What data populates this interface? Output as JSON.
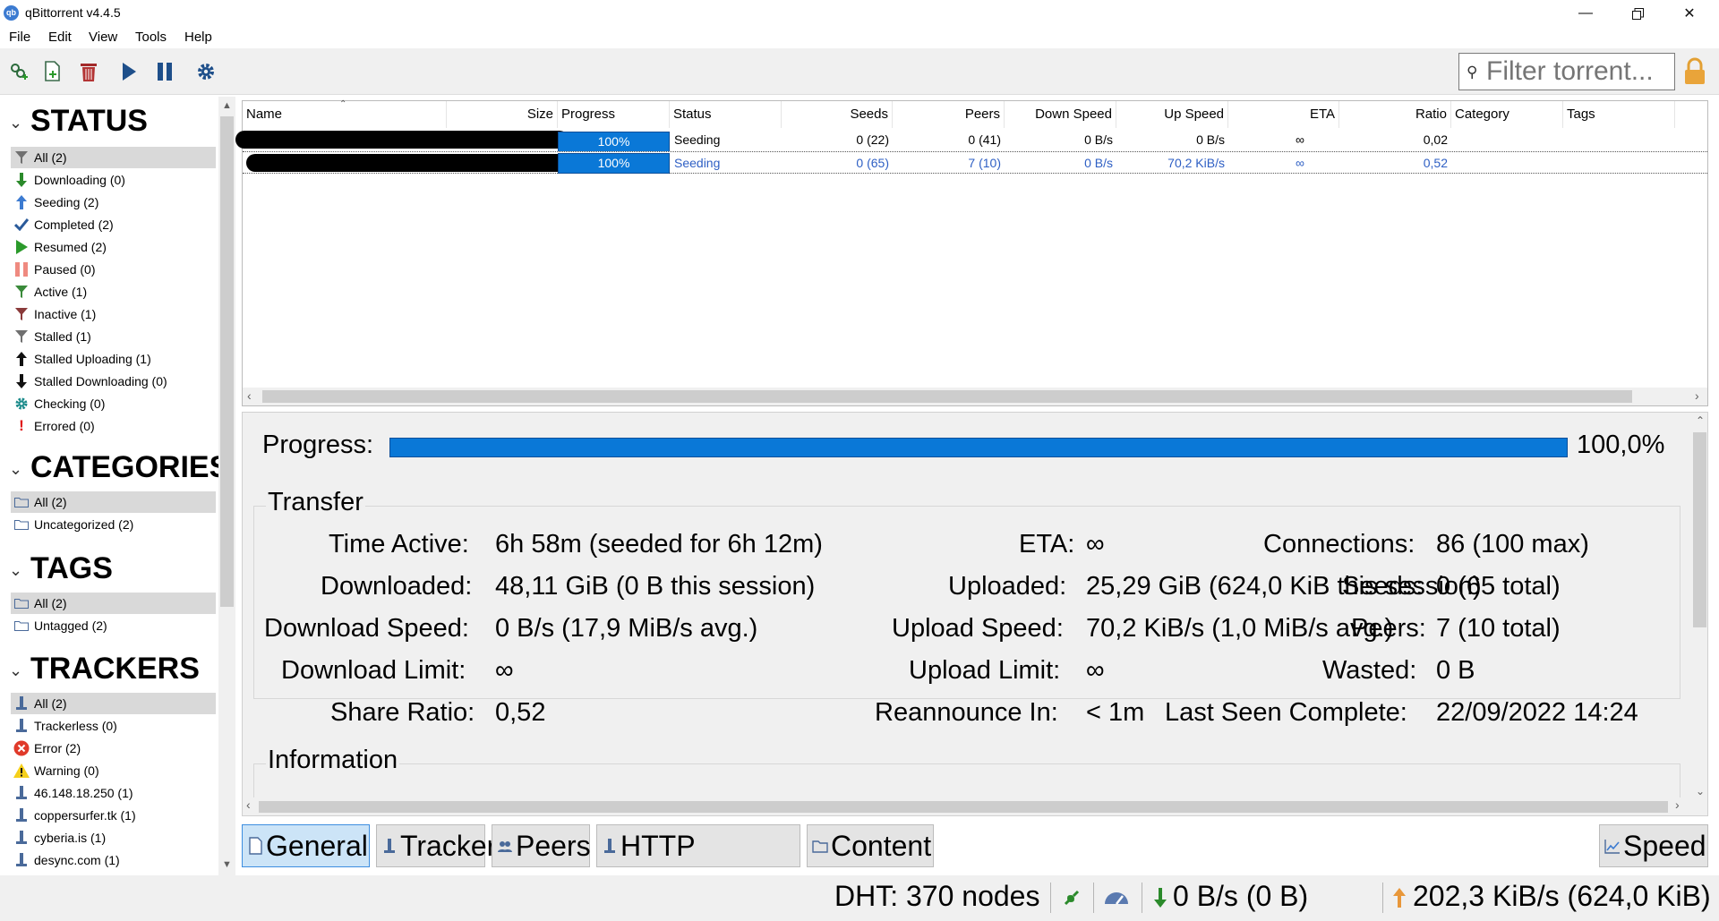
{
  "window": {
    "title": "qBittorrent v4.4.5",
    "icon_text": "qb"
  },
  "menu": [
    "File",
    "Edit",
    "View",
    "Tools",
    "Help"
  ],
  "toolbar": {
    "filter_placeholder": "Filter torrent..."
  },
  "sidebar": {
    "status_header": "STATUS",
    "status_items": [
      {
        "label": "All (2)",
        "icon": "filter-icon"
      },
      {
        "label": "Downloading (0)",
        "icon": "download-arrow-icon"
      },
      {
        "label": "Seeding (2)",
        "icon": "upload-arrow-icon"
      },
      {
        "label": "Completed (2)",
        "icon": "checkmark-icon"
      },
      {
        "label": "Resumed (2)",
        "icon": "play-icon"
      },
      {
        "label": "Paused (0)",
        "icon": "pause-icon"
      },
      {
        "label": "Active (1)",
        "icon": "filter-green-icon"
      },
      {
        "label": "Inactive (1)",
        "icon": "filter-red-icon"
      },
      {
        "label": "Stalled (1)",
        "icon": "filter-gray-icon"
      },
      {
        "label": "Stalled Uploading (1)",
        "icon": "stalled-up-icon"
      },
      {
        "label": "Stalled Downloading (0)",
        "icon": "stalled-down-icon"
      },
      {
        "label": "Checking (0)",
        "icon": "gear-icon"
      },
      {
        "label": "Errored (0)",
        "icon": "exclamation-icon"
      }
    ],
    "categories_header": "CATEGORIES",
    "category_items": [
      {
        "label": "All (2)",
        "icon": "folder-icon"
      },
      {
        "label": "Uncategorized (2)",
        "icon": "folder-icon"
      }
    ],
    "tags_header": "TAGS",
    "tag_items": [
      {
        "label": "All (2)",
        "icon": "folder-icon"
      },
      {
        "label": "Untagged (2)",
        "icon": "folder-icon"
      }
    ],
    "trackers_header": "TRACKERS",
    "tracker_items": [
      {
        "label": "All (2)",
        "icon": "tracker-icon"
      },
      {
        "label": "Trackerless (0)",
        "icon": "tracker-icon"
      },
      {
        "label": "Error (2)",
        "icon": "error-icon"
      },
      {
        "label": "Warning (0)",
        "icon": "warning-icon"
      },
      {
        "label": "46.148.18.250 (1)",
        "icon": "tracker-icon"
      },
      {
        "label": "coppersurfer.tk (1)",
        "icon": "tracker-icon"
      },
      {
        "label": "cyberia.is (1)",
        "icon": "tracker-icon"
      },
      {
        "label": "desync.com (1)",
        "icon": "tracker-icon"
      }
    ]
  },
  "torrent_list": {
    "columns": [
      "Name",
      "Size",
      "Progress",
      "Status",
      "Seeds",
      "Peers",
      "Down Speed",
      "Up Speed",
      "ETA",
      "Ratio",
      "Category",
      "Tags"
    ],
    "rows": [
      {
        "progress": "100%",
        "progress_value": 1.0,
        "status": "Seeding",
        "seeds": "0 (22)",
        "peers": "0 (41)",
        "down": "0 B/s",
        "up": "0 B/s",
        "eta": "∞",
        "ratio": "0,02"
      },
      {
        "progress": "100%",
        "progress_value": 1.0,
        "status": "Seeding",
        "seeds": "0 (65)",
        "peers": "7 (10)",
        "down": "0 B/s",
        "up": "70,2 KiB/s",
        "eta": "∞",
        "ratio": "0,52"
      }
    ]
  },
  "details": {
    "progress_label": "Progress:",
    "progress_value_text": "100,0%",
    "progress_value": 1.0,
    "transfer_title": "Transfer",
    "information_title": "Information",
    "fields": {
      "time_active_label": "Time Active:",
      "time_active": "6h 58m (seeded for 6h 12m)",
      "eta_label": "ETA:",
      "eta": "∞",
      "connections_label": "Connections:",
      "connections": "86 (100 max)",
      "downloaded_label": "Downloaded:",
      "downloaded": "48,11 GiB (0 B this session)",
      "uploaded_label": "Uploaded:",
      "uploaded": "25,29 GiB (624,0 KiB this session)",
      "seeds_label": "Seeds:",
      "seeds": "0 (65 total)",
      "dl_speed_label": "Download Speed:",
      "dl_speed": "0 B/s (17,9 MiB/s avg.)",
      "ul_speed_label": "Upload Speed:",
      "ul_speed": "70,2 KiB/s (1,0 MiB/s avg.)",
      "peers_label": "Peers:",
      "peers": "7 (10 total)",
      "dl_limit_label": "Download Limit:",
      "dl_limit": "∞",
      "ul_limit_label": "Upload Limit:",
      "ul_limit": "∞",
      "wasted_label": "Wasted:",
      "wasted": "0 B",
      "share_ratio_label": "Share Ratio:",
      "share_ratio": "0,52",
      "reannounce_label": "Reannounce In:",
      "reannounce": "< 1m",
      "last_seen_label": "Last Seen Complete:",
      "last_seen": "22/09/2022 14:24"
    }
  },
  "tabs": [
    "General",
    "Trackers",
    "Peers",
    "HTTP Sources",
    "Content"
  ],
  "speed_button": "Speed",
  "statusbar": {
    "dht": "DHT: 370 nodes",
    "download": "0 B/s (0 B)",
    "upload": "202,3 KiB/s (624,0 KiB)"
  },
  "colors": {
    "accent": "#0a78d7",
    "selected_text": "#2e5fc4",
    "tab_active": "#cce4f7"
  }
}
